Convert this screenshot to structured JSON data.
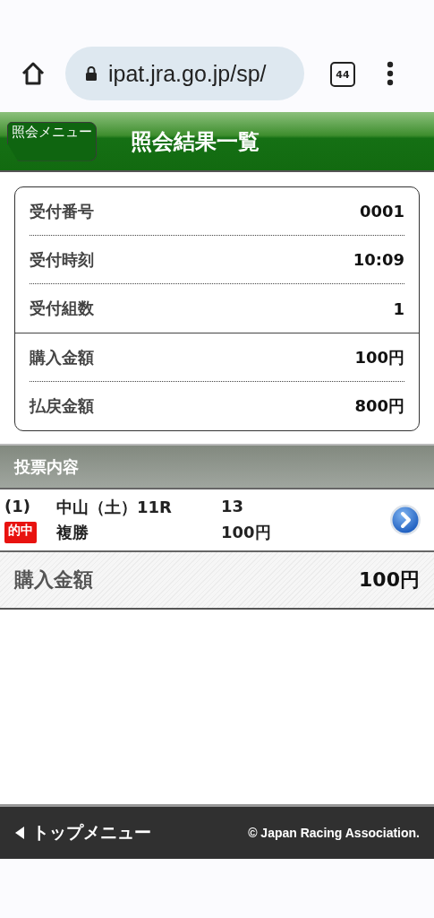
{
  "browser": {
    "url": "ipat.jra.go.jp/sp/",
    "tab_count": "44"
  },
  "header": {
    "back_label": "照会メニュー",
    "title": "照会結果一覧"
  },
  "summary": {
    "reception": [
      {
        "label": "受付番号",
        "value": "0001"
      },
      {
        "label": "受付時刻",
        "value": "10:09"
      },
      {
        "label": "受付組数",
        "value": "1"
      }
    ],
    "amounts": [
      {
        "label": "購入金額",
        "value": "100円"
      },
      {
        "label": "払戻金額",
        "value": "800円"
      }
    ]
  },
  "bets_section": {
    "title": "投票内容",
    "bets": [
      {
        "index": "(1)",
        "race": "中山（土）11R",
        "numbers": "13",
        "result": "的中",
        "bet_type": "複勝",
        "amount": "100円"
      }
    ]
  },
  "total": {
    "label": "購入金額",
    "value": "100円"
  },
  "footer": {
    "link": "トップメニュー",
    "copyright": "© Japan Racing Association."
  }
}
